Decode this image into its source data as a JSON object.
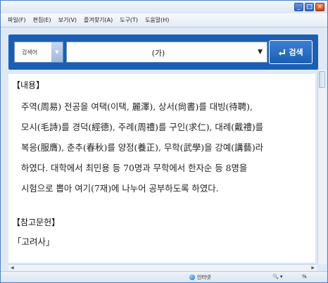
{
  "menu": [
    "파일(F)",
    "편집(E)",
    "보기(V)",
    "즐겨찾기(A)",
    "도구(T)",
    "도움말(H)"
  ],
  "window_buttons": [
    "_",
    "□",
    "×"
  ],
  "search": {
    "category_label": "검색어",
    "query_value": "(가)",
    "button_label": "검색",
    "button_icon": "enter-arrow-icon"
  },
  "content": {
    "section1_title": "【내용】",
    "lines": [
      "주역(周易) 전공을 여택(이택, 麗澤), 상서(尙書)를 대빙(待聘),",
      "모시(毛詩)를 경덕(經德), 주례(周禮)를 구인(求仁), 대례(戴禮)를",
      "복응(服膺), 춘추(春秋)를 양정(養正), 무학(武學)을 강예(講藝)라",
      "하였다. 대학에서 최민용 등 70명과 무학에서 한자순 등 8명을",
      "시험으로 뽑아 여기(7재)에 나누어 공부하도록 하였다."
    ],
    "section2_title": "【참고문헌】",
    "reference": "「고려사」"
  },
  "status": {
    "zone": "인터넷",
    "zoom": "%"
  },
  "colors": {
    "accent": "#1a5fb4",
    "frame": "#dfe9f6"
  }
}
